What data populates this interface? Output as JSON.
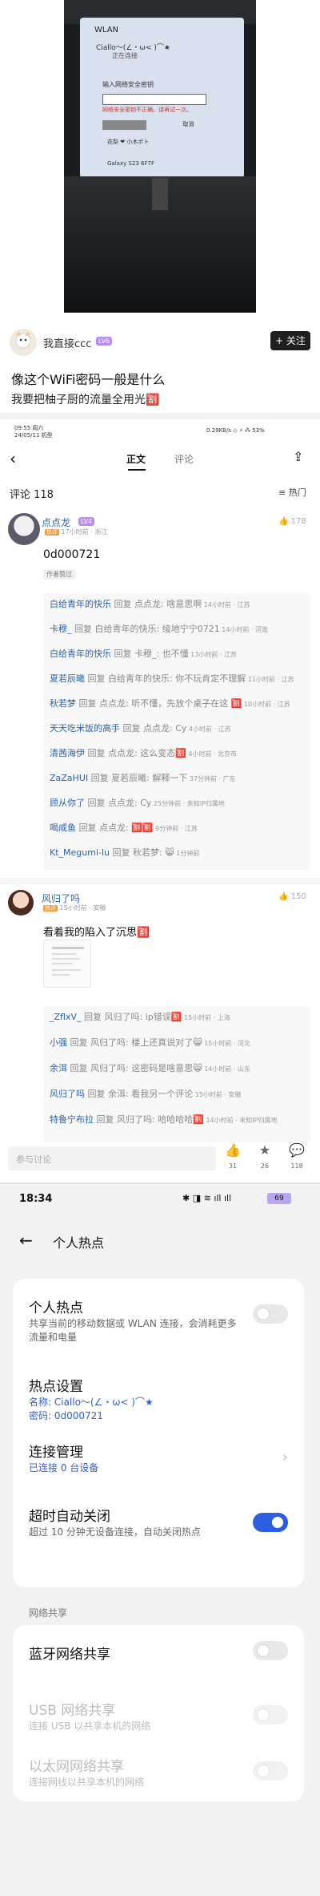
{
  "photo": {
    "wlan_title": "WLAN",
    "network_name": "Ciallo～(∠・ω< )⌒★",
    "status": "正在连接",
    "password_prompt": "输入网络安全密钥",
    "error_text": "网络安全密钥不正确。请再试一次。",
    "cancel_label": "取消",
    "net1": "花梨 ❤ 小木ボト",
    "net2": "Galaxy S23 6F7F"
  },
  "post": {
    "author_name": "我直接ccc",
    "author_level": "LV6",
    "follow_label": "+ 关注",
    "title": "像这个WiFi密码一般是什么",
    "body": "我要把柚子厨的流量全用光🈹"
  },
  "comments_page": {
    "status_left": "09:55 周六\n24/05/11 机型",
    "status_right": "0.29KB/s  ◇  ⚡  ⁂ 53%",
    "battery": "53%",
    "tabs": [
      "正文",
      "评论"
    ],
    "comment_count": "评论 118",
    "sort_label": "≡ 热门",
    "c1": {
      "name": "点点龙",
      "level": "LV4",
      "hot": "热评",
      "meta": "17小时前 · 浙江",
      "likes": "178",
      "text": "0d000721",
      "author_tag": "作者赞过"
    },
    "replies1": [
      {
        "user": "白给青年的快乐",
        "text": " 回复 点点龙: 啥意思啊",
        "meta": " 14小时前 · 江苏"
      },
      {
        "user": "卡穆_",
        "text": " 回复 白给青年的快乐: 绫地宁宁0721",
        "meta": " 14小时前 · 河南"
      },
      {
        "user": "白给青年的快乐",
        "text": " 回复 卡穆_: 也不懂",
        "meta": " 13小时前 · 江苏"
      },
      {
        "user": "夏若辰曦",
        "text": " 回复 白给青年的快乐: 你不玩肯定不理解",
        "meta": " 11小时前 · 江苏"
      },
      {
        "user": "秋若梦",
        "text": " 回复 点点龙: 听不懂，先放个桌子在这 🈹",
        "meta": " 10小时前 · 江苏"
      },
      {
        "user": "天天吃米饭的高手",
        "text": " 回复 点点龙: Cy",
        "meta": " 4小时前 · 江苏"
      },
      {
        "user": "清茜海伊",
        "text": " 回复 点点龙: 这么变态🈹",
        "meta": " 4小时前 · 北京市"
      },
      {
        "user": "ZaZaHUI",
        "text": " 回复 夏若辰曦: 解释一下",
        "meta": " 37分钟前 · 广东"
      },
      {
        "user": "顾从你了",
        "text": " 回复 点点龙: Cy",
        "meta": " 25分钟前 · 未知IP归属地"
      },
      {
        "user": "喝咸鱼",
        "text": " 回复 点点龙: 🈹🈹",
        "meta": " 9分钟前 · 江苏"
      },
      {
        "user": "Kt_Megumi-lu",
        "text": " 回复 秋若梦: 😸",
        "meta": " 1分钟前"
      }
    ],
    "c2": {
      "name": "风归了吗",
      "level": "LV4",
      "hot": "热评",
      "meta": "15小时前 · 安徽",
      "likes": "150",
      "text": "看着我的陷入了沉思🈹"
    },
    "replies2": [
      {
        "user": "_ZflxV_",
        "text": " 回复 风归了吗: ip错误🈹",
        "meta": " 15小时前 · 上海"
      },
      {
        "user": "小强",
        "text": " 回复 风归了吗: 楼上还真说对了😸",
        "meta": " 15小时前 · 河北"
      },
      {
        "user": "余洱",
        "text": " 回复 风归了吗: 这密码是啥意思😸",
        "meta": " 14小时前 · 山东"
      },
      {
        "user": "风归了吗",
        "text": " 回复 余洱: 看我另一个评论",
        "meta": " 15小时前 · 安徽"
      },
      {
        "user": "特鲁宁布拉",
        "text": " 回复 风归了吗: 哈哈哈哈🈹",
        "meta": " 14小时前 · 未知IP归属地"
      }
    ],
    "input_placeholder": "参与讨论",
    "actions": [
      {
        "icon": "👍",
        "count": "31"
      },
      {
        "icon": "★",
        "count": "26"
      },
      {
        "icon": "💬",
        "count": "118"
      }
    ]
  },
  "hotspot": {
    "time": "18:34",
    "status_icons": "✱ ◨ ≋ ıll ıll",
    "battery": "69",
    "title": "个人热点",
    "personal_title": "个人热点",
    "personal_sub": "共享当前的移动数据或 WLAN 连接，会消耗更多流量和电量",
    "settings_title": "热点设置",
    "settings_name": "名称: Ciallo～(∠・ω< )⌒★",
    "settings_pw": "密码: 0d000721",
    "manage_title": "连接管理",
    "manage_sub": "已连接 0 台设备",
    "auto_title": "超时自动关闭",
    "auto_sub": "超过 10 分钟无设备连接，自动关闭热点",
    "share_section": "网络共享",
    "bt_title": "蓝牙网络共享",
    "usb_title": "USB 网络共享",
    "usb_sub": "连接 USB 以共享本机的网络",
    "eth_title": "以太网网络共享",
    "eth_sub": "连接网线以共享本机的网络"
  }
}
